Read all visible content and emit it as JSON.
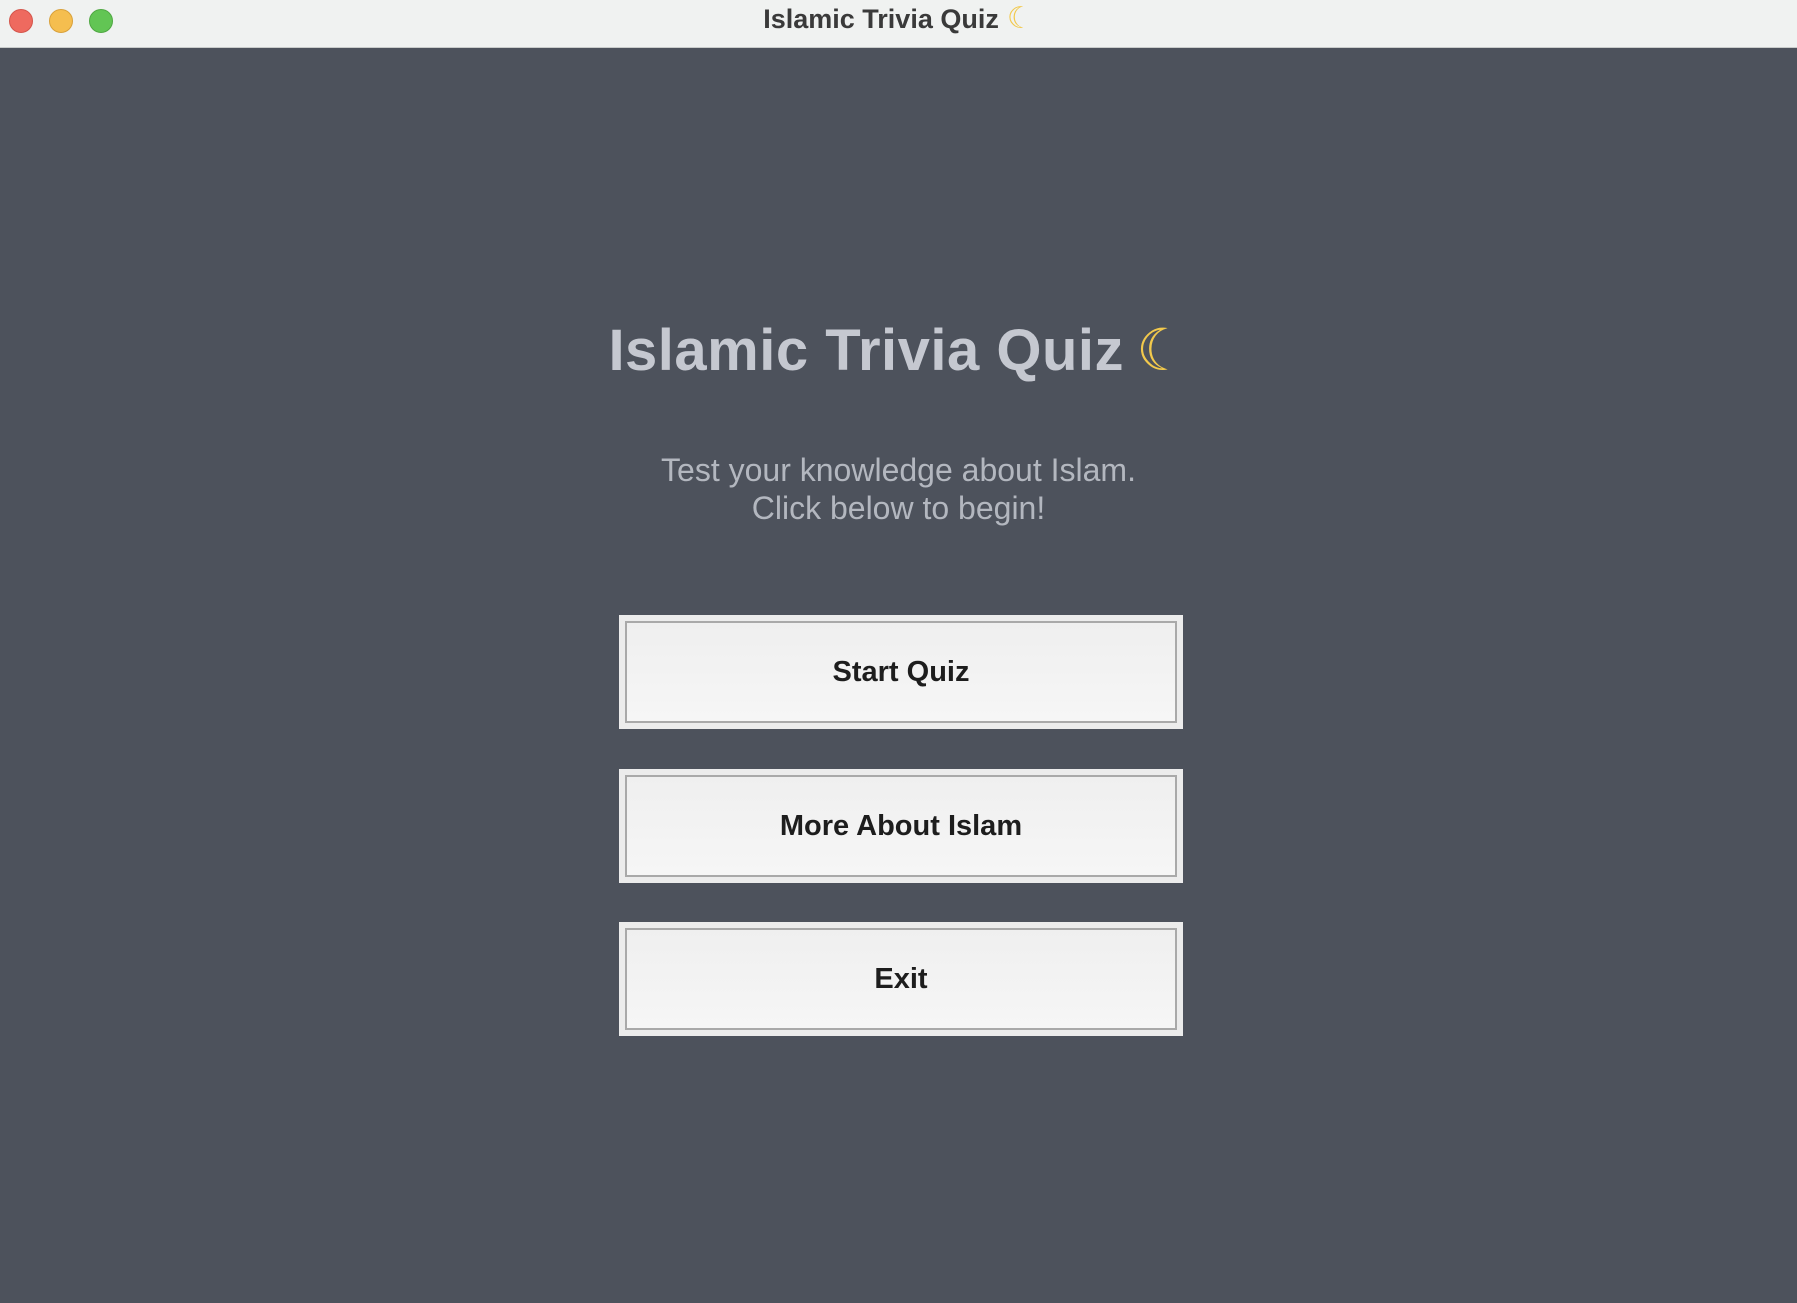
{
  "window": {
    "title": "Islamic Trivia Quiz",
    "title_icon": "crescent-moon-icon",
    "controls": [
      "close",
      "minimize",
      "maximize"
    ]
  },
  "main": {
    "heading": "Islamic Trivia Quiz",
    "heading_icon": "crescent-moon-icon",
    "subtitle_line1": "Test your knowledge about Islam.",
    "subtitle_line2": "Click below to begin!"
  },
  "buttons": {
    "start": "Start Quiz",
    "more": "More About Islam",
    "exit": "Exit"
  },
  "colors": {
    "background": "#4d525c",
    "heading_text": "#c5c8d0",
    "subtitle_text": "#b3b7bf",
    "button_face": "#efefef",
    "button_text": "#1d1d1d"
  }
}
